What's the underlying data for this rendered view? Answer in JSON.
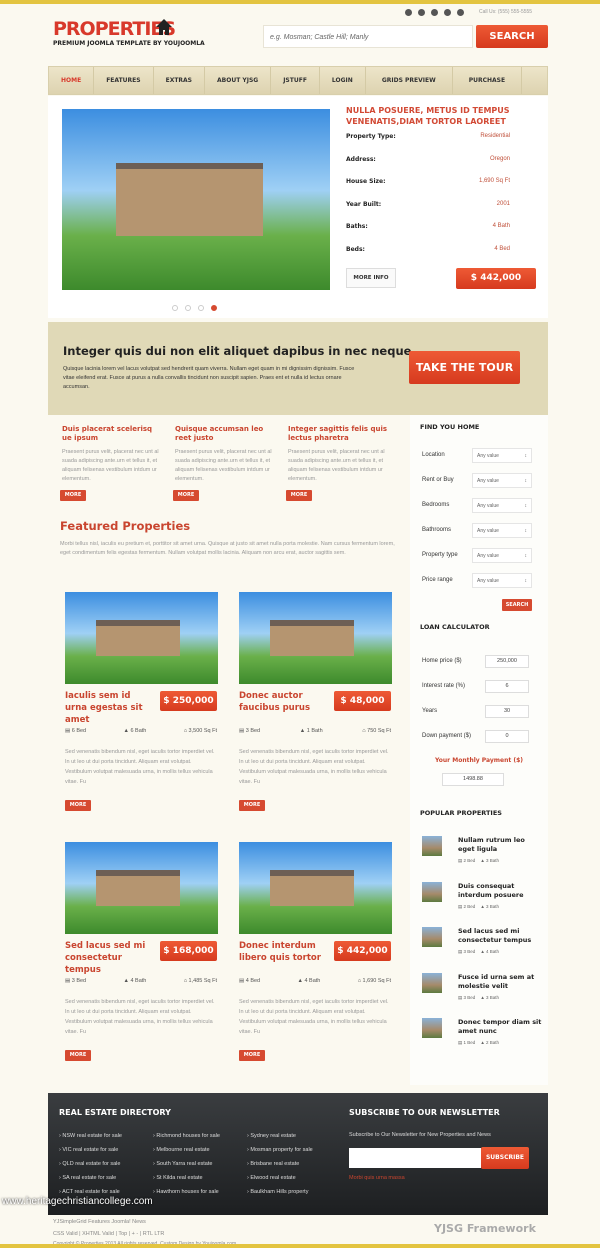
{
  "header": {
    "logo": "PROPERTIES",
    "tagline": "PREMIUM JOOMLA TEMPLATE BY YOUJOOMLA",
    "call": "Call Us: (555) 555-5555",
    "search_placeholder": "e.g. Mosman; Castle Hill; Manly",
    "search_label": "SEARCH",
    "social_icons": [
      "twitter-icon",
      "pinterest-icon",
      "linkedin-icon",
      "google-icon",
      "facebook-icon"
    ]
  },
  "nav": [
    "HOME",
    "FEATURES",
    "EXTRAS",
    "ABOUT YJSG",
    "JSTUFF",
    "LOGIN",
    "GRIDS PREVIEW",
    "PURCHASE"
  ],
  "slider": {
    "title": "NULLA POSUERE, METUS ID TEMPUS VENENATIS,DIAM TORTOR LAOREET",
    "rows": [
      [
        "Property Type:",
        "Residential"
      ],
      [
        "Address:",
        "Oregon"
      ],
      [
        "House Size:",
        "1,690 Sq Ft"
      ],
      [
        "Year Built:",
        "2001"
      ],
      [
        "Baths:",
        "4 Bath"
      ],
      [
        "Beds:",
        "4 Bed"
      ]
    ],
    "more": "MORE INFO",
    "price": "$ 442,000",
    "active_slide": 4,
    "slides": 4
  },
  "tour": {
    "title": "Integer quis dui non elit aliquet dapibus in nec neque",
    "text": "Quisque lacinia lorem vel lacus volutpat sed hendrerit quam viverra. Nullam eget quam in mi dignissim dignissim. Fusce vitae eleifend erat. Fusce at purus a nulla convallis tincidunt non suscipit sapien. Praes ent et nulla id lectus ornare accumsan.",
    "button": "TAKE THE TOUR"
  },
  "columns": [
    {
      "title": "Duis placerat scelerisq ue ipsum",
      "text": "Praesent purus velit, placerat nec unt al suada adipiscing ante.urn et tellus it, et aliquam felisenas vestibulum intdum ur elementum."
    },
    {
      "title": "Quisque accumsan leo reet justo",
      "text": "Praesent purus velit, placerat nec unt al suada adipiscing ante.urn et tellus it, et aliquam felisenas vestibulum intdum ur elementum."
    },
    {
      "title": "Integer sagittis felis quis lectus pharetra",
      "text": "Praesent purus velit, placerat nec unt al suada adipiscing ante.urn et tellus it, et aliquam felisenas vestibulum intdum ur elementum."
    }
  ],
  "more": "MORE",
  "featured": {
    "title": "Featured Properties",
    "text": "Morbi tellus nisl, iaculis eu pretium et, porttitor sit amet urna. Quisque at justo sit amet nulla porta molestie. Nam cursus fermentum lorem, eget condimentum felis egestas fermentum. Nullam volutpat mollis lacinia. Aliquam non arcu erat, auctor sagittis sem.",
    "cards": [
      {
        "title": "Iaculis sem id urna egestas sit amet",
        "price": "$ 250,000",
        "bed": "6 Bed",
        "bath": "6 Bath",
        "size": "3,500 Sq Ft"
      },
      {
        "title": "Donec auctor faucibus purus",
        "price": "$ 48,000",
        "bed": "3 Bed",
        "bath": "1 Bath",
        "size": "750 Sq Ft"
      },
      {
        "title": "Sed lacus sed mi consectetur tempus",
        "price": "$ 168,000",
        "bed": "3 Bed",
        "bath": "4 Bath",
        "size": "1,485 Sq Ft"
      },
      {
        "title": "Donec interdum libero quis tortor",
        "price": "$ 442,000",
        "bed": "4 Bed",
        "bath": "4 Bath",
        "size": "1,690 Sq Ft"
      }
    ],
    "card_text": "Sed venenatis bibendum nisl, eget iaculis tortor imperdiet vel. In ut leo ut dui porta tincidunt. Aliquam erat volutpat. Vestibulum volutpat malesuada urna, in mollis tellus vehicula vitae. Fu"
  },
  "find": {
    "title": "FIND YOU HOME",
    "fields": [
      [
        "Location",
        "Any value"
      ],
      [
        "Rent or Buy",
        "Any value"
      ],
      [
        "Bedrooms",
        "Any value"
      ],
      [
        "Bathrooms",
        "Any value"
      ],
      [
        "Property type",
        "Any value"
      ],
      [
        "Price range",
        "Any value"
      ]
    ],
    "button": "SEARCH"
  },
  "loan": {
    "title": "LOAN CALCULATOR",
    "fields": [
      [
        "Home price ($)",
        "250,000"
      ],
      [
        "Interest rate (%)",
        "6"
      ],
      [
        "Years",
        "30"
      ],
      [
        "Down payment ($)",
        "0"
      ]
    ],
    "result_label": "Your Monthly Payment ($)",
    "result": "1498.88"
  },
  "popular": {
    "title": "POPULAR PROPERTIES",
    "items": [
      {
        "name": "Nullam rutrum leo eget ligula",
        "bed": "2 Bed",
        "bath": "3 Bath"
      },
      {
        "name": "Duis consequat interdum posuere",
        "bed": "2 Bed",
        "bath": "3 Bath"
      },
      {
        "name": "Sed lacus sed mi consectetur tempus",
        "bed": "3 Bed",
        "bath": "4 Bath"
      },
      {
        "name": "Fusce id urna sem at molestie velit",
        "bed": "3 Bed",
        "bath": "3 Bath"
      },
      {
        "name": "Donec tempor diam sit amet nunc",
        "bed": "1 Bed",
        "bath": "2 Bath"
      }
    ]
  },
  "footer": {
    "dir_title": "REAL ESTATE DIRECTORY",
    "cols": [
      [
        "NSW real estate for sale",
        "VIC real estate for sale",
        "QLD real estate for sale",
        "SA real estate for sale",
        "ACT real estate for sale"
      ],
      [
        "Richmond houses for sale",
        "Melbourne real estate",
        "South Yarra real estate",
        "St Kilda real estate",
        "Hawthorn houses for sale"
      ],
      [
        "Sydney real estate",
        "Mosman property for sale",
        "Brisbane real estate",
        "Elwood real estate",
        "Baulkham Hills property"
      ]
    ],
    "news_title": "SUBSCRIBE TO OUR NEWSLETTER",
    "news_text": "Subscribe to Our Newsletter for New Properties and News",
    "subscribe": "SUBSCRIBE",
    "news_note": "Morbi quis urna massa",
    "links1": "YJSimpleGrid Features   Joomla! News",
    "links2": "CSS Valid | XHTML Valid | Top | + - | RTL LTR",
    "copyright": "Copyright © Properties 2013 All rights reserved. Custom Design by Youjoomla.com",
    "framework": "YJSG Framework",
    "watermark": "www.heritagechristiancollege.com"
  }
}
